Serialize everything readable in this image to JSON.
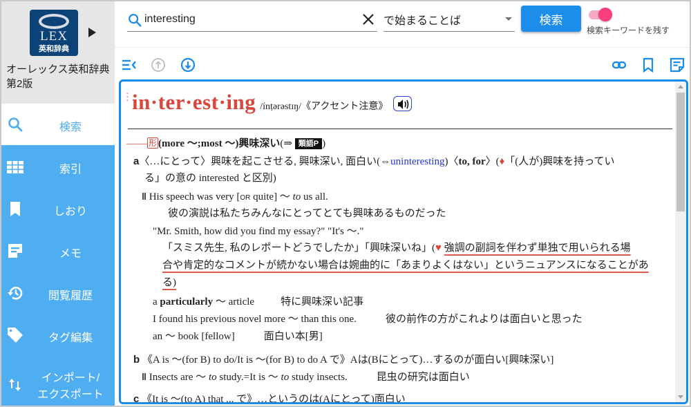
{
  "sidebar": {
    "logo": {
      "mark": "LEX",
      "subtitle": "英和辞典"
    },
    "dictionary_title": "オーレックス英和辞典 第2版",
    "items": [
      {
        "label": "検索",
        "icon": "search-icon",
        "active": true
      },
      {
        "label": "索引",
        "icon": "grid-icon",
        "active": false
      },
      {
        "label": "しおり",
        "icon": "bookmark-icon",
        "active": false
      },
      {
        "label": "メモ",
        "icon": "memo-icon",
        "active": false
      },
      {
        "label": "閲覧履歴",
        "icon": "history-icon",
        "active": false
      },
      {
        "label": "タグ編集",
        "icon": "tag-icon",
        "active": false
      },
      {
        "label": "インポート/",
        "label2": "エクスポート",
        "icon": "import-export-icon",
        "active": false
      }
    ]
  },
  "search": {
    "query": "interesting",
    "mode": "で始まることば",
    "button_label": "検索",
    "keep_keyword_label": "検索キーワードを残す",
    "keep_keyword_on": true
  },
  "toolbar": {
    "left": [
      "collapse-icon",
      "arrow-up-circle-icon",
      "arrow-down-circle-icon"
    ],
    "right": [
      "link-icon",
      "bookmark-icon",
      "memo-icon"
    ]
  },
  "colors": {
    "accent": "#1a8be8",
    "sidebar": "#4fadf2",
    "headword": "#d9463c",
    "toggle": "#fb3f7c"
  },
  "entry": {
    "headword": "in·ter·est·ing",
    "stars": "***",
    "pronunciation": "/ínṭərəstɪŋ/",
    "accent_note": "《アクセント注意》",
    "pos_line": {
      "dash": "——",
      "pos": "形",
      "forms": "(more ～;most ～)",
      "gloss": "興味深い",
      "ref_open": "(⇒",
      "ref_badge": "類語P",
      "ref_close": ")"
    },
    "sense_a": {
      "label": "a",
      "line1_pre": "〈…にとって〉興味を起こさせる, 興味深い, 面白い(⇔",
      "antonym": "uninteresting",
      "line1_mid": ")〈",
      "prep": "to, for",
      "line1_post": "〉(",
      "diamond": "♦",
      "line1_end": "「(人が)興味を持ってい",
      "line2": "る」の意の interested と区別)",
      "examples": [
        {
          "mark": "‖",
          "en_pre": "His speech was very [",
          "or": "OR",
          "en_mid": " quite] ～ ",
          "en_it": "to",
          "en_post": " us all.",
          "ja": "彼の演説は私たちみんなにとってとても興味あるものだった"
        },
        {
          "en": "\"Mr. Smith, how did you find my essay?\" \"It's ～.\"",
          "ja_pre": "「スミス先生, 私のレポートどうでしたか」「興味深いね」(",
          "heart": "♥",
          "note1": "強調の副詞を伴わず単独で用いられる場",
          "note2": "合や肯定的なコメントが続かない場合は婉曲的に「あまりよくはない」というニュアンスになることがあ",
          "note3": "る)"
        },
        {
          "en_pre": "a ",
          "en_bold": "particularly",
          "en_post": " ～ article",
          "ja": "特に興味深い記事"
        },
        {
          "en": "I found his previous novel more ～ than this one.",
          "ja": "彼の前作の方がこれよりは面白いと思った"
        },
        {
          "en": "an ～ book [fellow]",
          "ja": "面白い本[男]"
        }
      ]
    },
    "sense_b": {
      "label": "b",
      "pattern": "《A is ～(for B) to do/It is ～(for B) to do A で》Aは(Bにとって)…するのが面白い[興味深い]",
      "example_mark": "‖",
      "example_en_pre": "Insects are ～ ",
      "example_en_it1": "to",
      "example_en_mid": " study.=It is ～ ",
      "example_en_it2": "to",
      "example_en_post": " study insects.",
      "example_ja": "昆虫の研究は面白い"
    },
    "sense_c": {
      "label": "c",
      "pattern": "《It is ～(to A) that ... で》…というのは(Aにとって)面白い"
    }
  }
}
